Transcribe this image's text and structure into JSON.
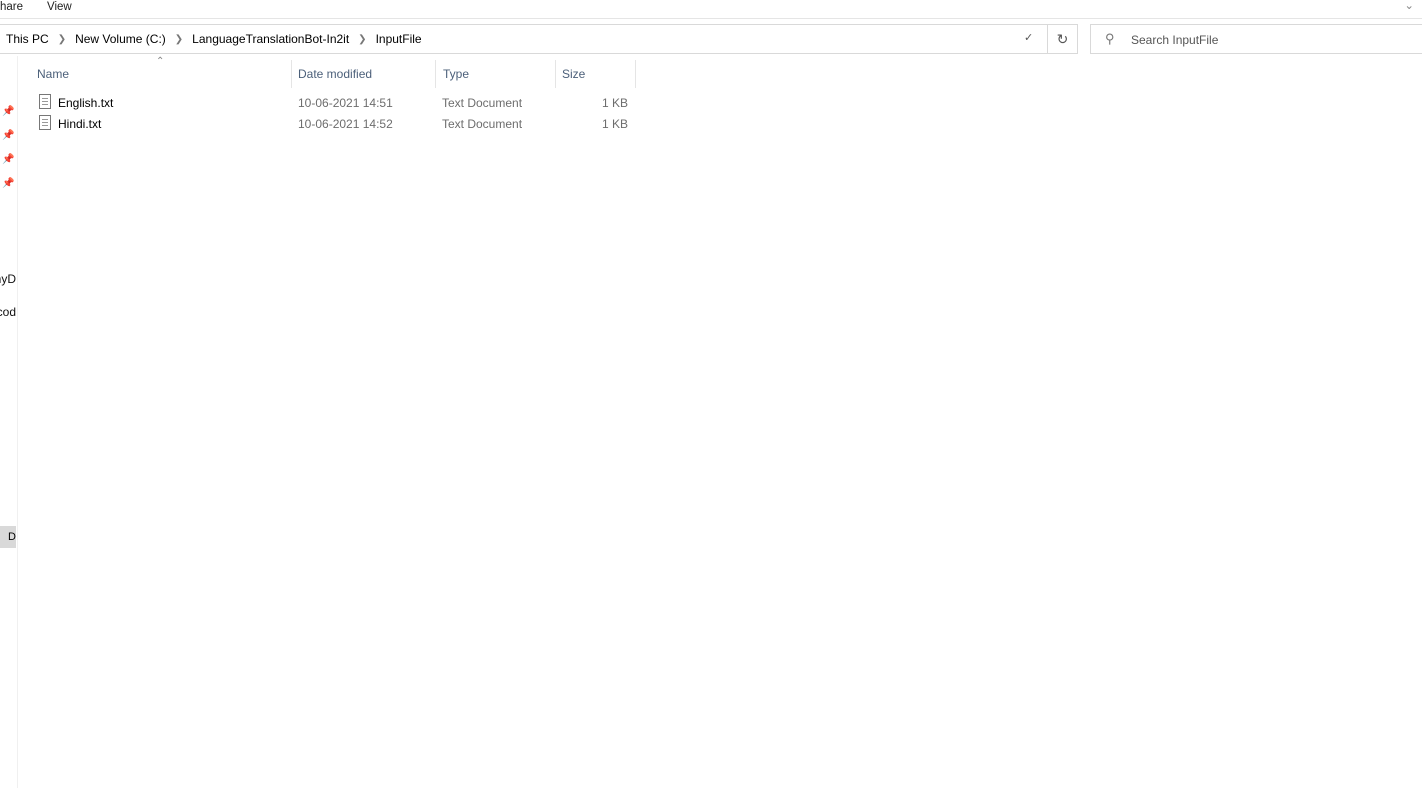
{
  "ribbon": {
    "tabs": [
      "hare",
      "View"
    ]
  },
  "address": {
    "crumbs": [
      "This PC",
      "New Volume (C:)",
      "LanguageTranslationBot-In2it",
      "InputFile"
    ]
  },
  "search": {
    "placeholder": "Search InputFile"
  },
  "nav": {
    "items": [
      "nyD",
      "cod",
      "D"
    ]
  },
  "columns": [
    "Name",
    "Date modified",
    "Type",
    "Size"
  ],
  "files": [
    {
      "name": "English.txt",
      "date": "10-06-2021 14:51",
      "type": "Text Document",
      "size": "1 KB"
    },
    {
      "name": "Hindi.txt",
      "date": "10-06-2021 14:52",
      "type": "Text Document",
      "size": "1 KB"
    }
  ]
}
